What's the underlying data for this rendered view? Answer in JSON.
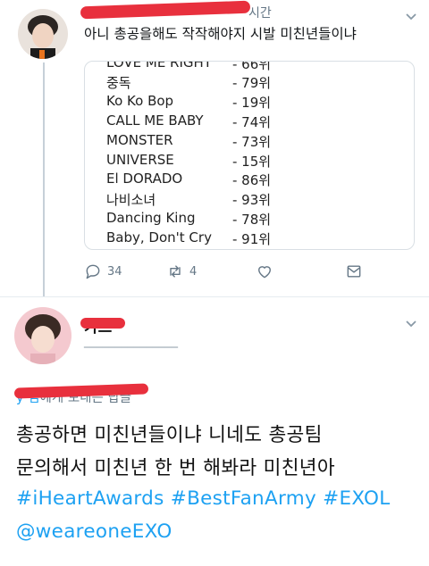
{
  "tweet1": {
    "time": "시간",
    "text": "아니 총공을해도 작작해야지 시발 미친년들이냐",
    "rank_list": [
      {
        "title": "LOVE ME RIGHT",
        "rank": "- 66위"
      },
      {
        "title": "중독",
        "rank": "- 79위"
      },
      {
        "title": "Ko Ko Bop",
        "rank": "- 19위"
      },
      {
        "title": "CALL ME BABY",
        "rank": "- 74위"
      },
      {
        "title": "MONSTER",
        "rank": "- 73위"
      },
      {
        "title": "UNIVERSE",
        "rank": "- 15위"
      },
      {
        "title": "El DORADO",
        "rank": "- 86위"
      },
      {
        "title": "나비소녀",
        "rank": "- 93위"
      },
      {
        "title": "Dancing King",
        "rank": "- 78위"
      },
      {
        "title": "Baby, Don't Cry",
        "rank": "- 91위"
      }
    ],
    "actions": {
      "reply_count": "34",
      "retweet_count": "4"
    }
  },
  "tweet2": {
    "name": "카드",
    "replying_to_user": "y 님",
    "replying_suffix": "에게 보내는 답글",
    "line1": "총공하면 미친년들이냐 니네도 총공팀",
    "line2": "문의해서 미친년 한 번 해봐라 미친년아",
    "hashtags": "#iHeartAwards #BestFanArmy #EXOL",
    "mention": "@weareoneEXO"
  },
  "colors": {
    "accent": "#1da1f2",
    "redact": "#e8303d",
    "muted": "#657786"
  },
  "icons": [
    "reply-icon",
    "retweet-icon",
    "like-icon",
    "share-icon",
    "chevron-down-icon"
  ]
}
